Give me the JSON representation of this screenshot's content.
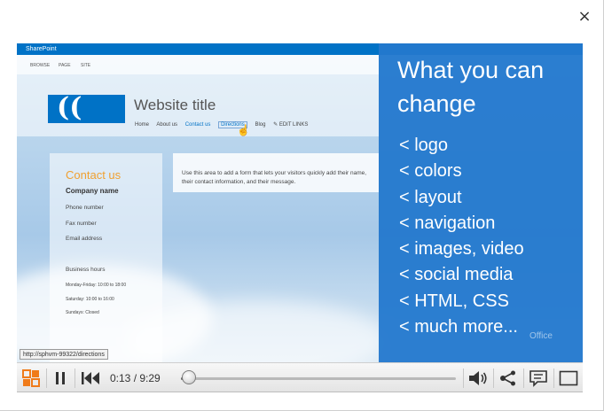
{
  "dialog": {
    "close_symbol": "×"
  },
  "video": {
    "sharepoint": {
      "suite_bar_label": "SharePoint",
      "ribbon_tabs": [
        "BROWSE",
        "PAGE",
        "SITE"
      ],
      "logo_glyph": "((",
      "site_title": "Website title",
      "nav": [
        "Home",
        "About us",
        "Contact us",
        "Directions",
        "Blog"
      ],
      "edit_links": "✎ EDIT LINKS",
      "contact_heading": "Contact us",
      "company_name": "Company name",
      "phone": "Phone number",
      "fax": "Fax number",
      "email": "Email address",
      "business_hours": "Business hours",
      "hours_weekday": "Monday-Friday: 10:00 to 18:00",
      "hours_saturday": "Saturday: 10:00 to 16:00",
      "hours_sunday": "Sundays: Closed",
      "note": "Use this area to add a form that lets your visitors quickly add their name, their contact information, and their message."
    },
    "panel": {
      "title": "What you can change",
      "items": [
        "< logo",
        "< colors",
        "< layout",
        "< navigation",
        "< images, video",
        "< social media",
        "< HTML, CSS",
        "< much more..."
      ],
      "watermark": "Office",
      "color": "#2378cd"
    },
    "status_url": "http://sphvm-99322/directions"
  },
  "player": {
    "current_time": "0:13",
    "duration": "9:29",
    "time_display": "0:13 / 9:29",
    "progress_fraction": 0.023,
    "is_playing": true
  },
  "colors": {
    "accent": "#0072c6",
    "contact_heading": "#f0a030",
    "logo_icon_orange": "#f07b1a"
  }
}
